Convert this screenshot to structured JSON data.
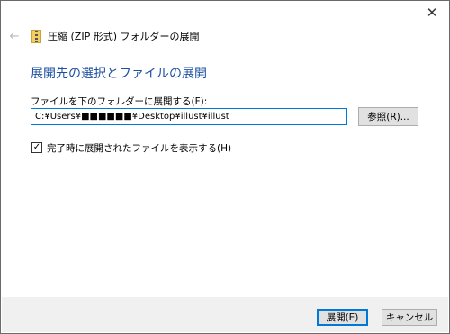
{
  "window": {
    "close_glyph": "✕",
    "back_glyph": "←",
    "title": "圧縮 (ZIP 形式) フォルダーの展開",
    "icons": {
      "back": "back-arrow-icon",
      "zip": "zip-folder-icon",
      "close": "close-icon",
      "check": "checkmark-icon"
    }
  },
  "main": {
    "heading": "展開先の選択とファイルの展開",
    "dest_label": "ファイルを下のフォルダーに展開する(F):",
    "dest_path": "C:¥Users¥■■■■■■¥Desktop¥illust¥illust",
    "browse_label": "参照(R)...",
    "show_files_checked": true,
    "check_glyph": "✓",
    "show_files_label": "完了時に展開されたファイルを表示する(H)"
  },
  "footer": {
    "extract_label": "展開(E)",
    "cancel_label": "キャンセル"
  },
  "colors": {
    "heading": "#1e50a2",
    "focus_border": "#0078d7",
    "footer_bg": "#f0f0f0"
  }
}
